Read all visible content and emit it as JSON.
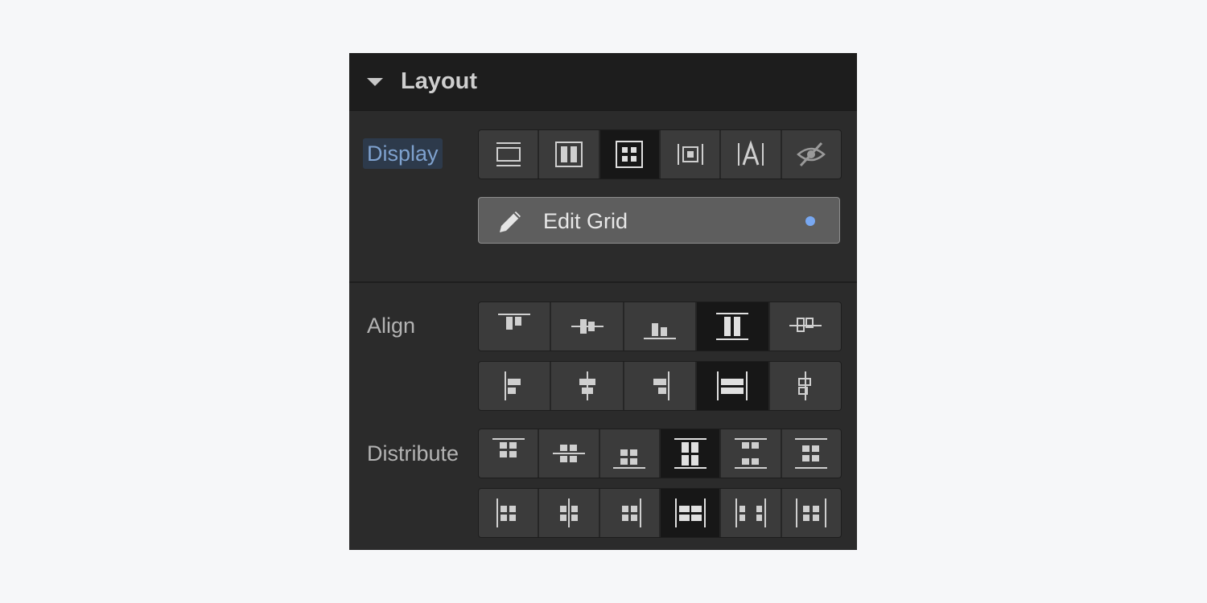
{
  "layout": {
    "title": "Layout",
    "display_label": "Display",
    "align_label": "Align",
    "distribute_label": "Distribute",
    "display_options": [
      {
        "icon": "display-block-icon"
      },
      {
        "icon": "display-flex-icon"
      },
      {
        "icon": "display-grid-icon",
        "selected": true
      },
      {
        "icon": "display-inline-block-icon"
      },
      {
        "icon": "display-inline-icon"
      },
      {
        "icon": "display-none-icon"
      }
    ],
    "edit_grid_label": "Edit Grid",
    "accent": "#78a8f2"
  }
}
